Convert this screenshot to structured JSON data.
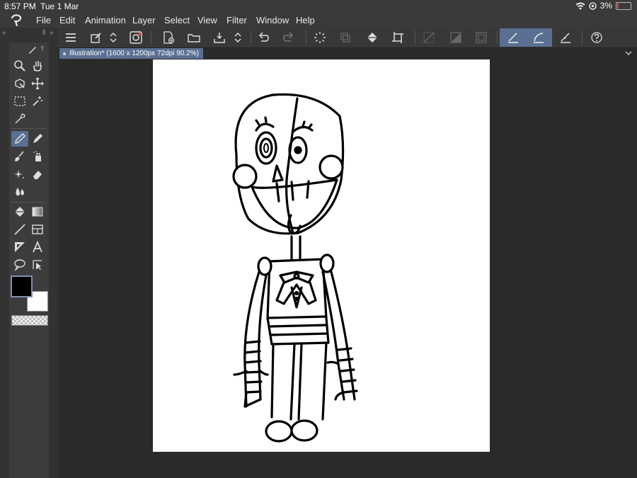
{
  "status": {
    "time": "8:57 PM",
    "date": "Tue 1 Mar",
    "battery": "3%"
  },
  "menu": [
    "File",
    "Edit",
    "Animation",
    "Layer",
    "Select",
    "View",
    "Filter",
    "Window",
    "Help"
  ],
  "tool_tabs": {
    "brush": "",
    "text": "T"
  },
  "tab": {
    "label": "Illustration* (1600 x 1200px 72dpi 90.2%)"
  },
  "colors": {
    "accent": "#5b6f92",
    "foreground": "#000000",
    "background": "#ffffff"
  },
  "toolbar_icons": [
    "menu-icon",
    "edit-canvas-icon",
    "scroll-arrows-icon",
    "record-icon",
    "new-file-icon",
    "open-folder-icon",
    "save-icon",
    "save-arrows-icon",
    "undo-icon",
    "redo-icon",
    "loading-icon",
    "transform-icon",
    "fill-icon",
    "crop-icon",
    "clear-icon",
    "fill-mask-icon",
    "invert-icon",
    "ruler-snap-icon",
    "special-ruler-snap-icon",
    "grid-snap-icon",
    "help-icon"
  ],
  "tools": [
    "zoom-tool",
    "hand-tool",
    "lasso-tool",
    "move-tool",
    "marquee-tool",
    "magic-wand-tool",
    "eyedropper-tool",
    "pen-tool",
    "pencil-tool",
    "brush-tool",
    "airbrush-tool",
    "decoration-tool",
    "eraser-tool",
    "blend-tool",
    "fill-tool",
    "gradient-tool",
    "line-tool",
    "frame-tool",
    "shape-tool",
    "text-tool",
    "balloon-tool",
    "operation-tool"
  ]
}
